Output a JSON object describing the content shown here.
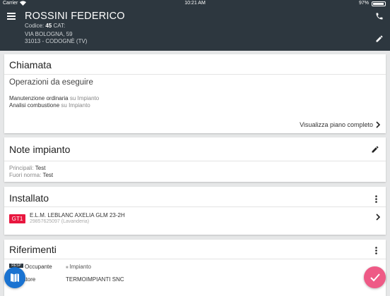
{
  "status_bar": {
    "carrier": "Carrier",
    "time": "10:21 AM",
    "battery": "97%"
  },
  "header": {
    "name": "ROSSINI FEDERICO",
    "codice_label": "Codice:",
    "codice_value": "45",
    "cat_label": "CAT:",
    "address_line1": "VIA BOLOGNA, 59",
    "address_line2": "31013 - CODOGNÈ (TV)"
  },
  "chiamata": {
    "title": "Chiamata",
    "subtitle": "Operazioni da eseguire",
    "operations": [
      {
        "name": "Manutenzione ordinaria",
        "target": "su Impianto"
      },
      {
        "name": "Analisi combustione",
        "target": "su Impianto"
      }
    ],
    "link": "Visualizza piano completo"
  },
  "note_impianto": {
    "title": "Note impianto",
    "principali_label": "Principali:",
    "principali_value": "Test",
    "fuori_norma_label": "Fuori norma:",
    "fuori_norma_value": "Test"
  },
  "installato": {
    "title": "Installato",
    "badge": "GT1",
    "device": "E.L.M. LEBLANC AXELIA GLM 23-2H",
    "serial": "29857625097 (Lavanderia)"
  },
  "riferimenti": {
    "title": "Riferimenti",
    "tag": "RESP",
    "occupante": "Occupante",
    "impianto": "Impianto",
    "role_partial": "atore",
    "company": "TERMOIMPIANTI SNC"
  },
  "colors": {
    "header_bg": "#2d373f",
    "badge_red": "#e8173f",
    "fab_blue": "#1a73d1",
    "fab_pink": "#ee5a86"
  }
}
